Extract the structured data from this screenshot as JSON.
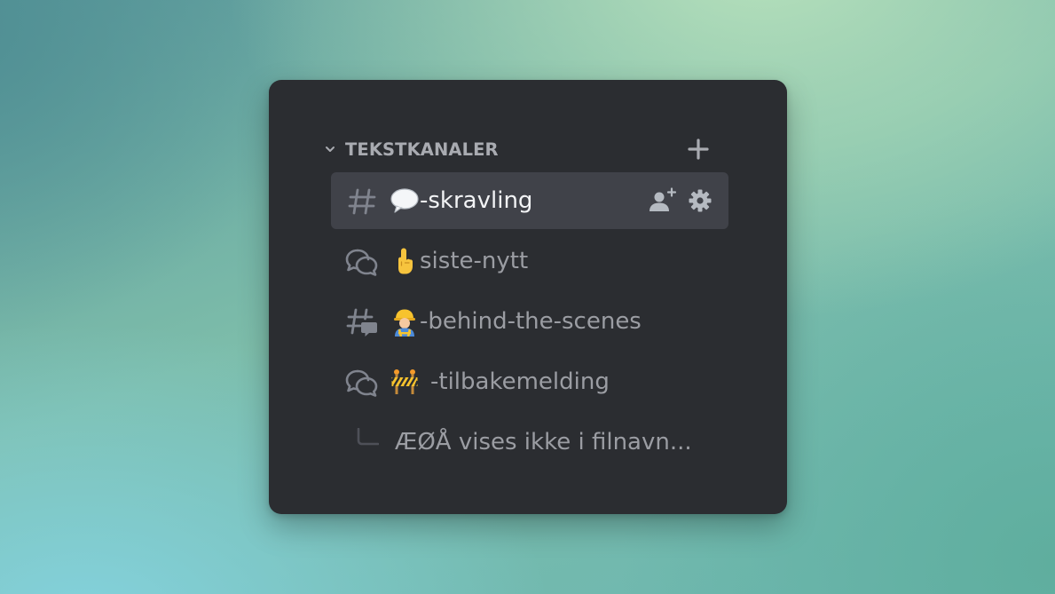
{
  "sidebar": {
    "category": {
      "label": "TEKSTKANALER",
      "collapse_icon": "chevron-down-icon",
      "add_icon": "plus-icon"
    },
    "channels": [
      {
        "type": "text",
        "icon": "hash-icon",
        "emoji": "speech-bubble",
        "name": "-skravling",
        "active": true,
        "actions": [
          "invite-user-icon",
          "gear-icon"
        ]
      },
      {
        "type": "forum",
        "icon": "forum-icon",
        "emoji": "pointing-up",
        "name": "siste-nytt",
        "active": false
      },
      {
        "type": "text-with-threads",
        "icon": "hash-thread-icon",
        "emoji": "construction-worker",
        "name": "-behind-the-scenes",
        "active": false
      },
      {
        "type": "forum",
        "icon": "forum-icon",
        "emoji": "construction-barrier",
        "name": "-tilbakemelding",
        "active": false
      }
    ],
    "thread": {
      "icon": "thread-spine-icon",
      "name": "ÆØÅ vises ikke i filnavn..."
    }
  },
  "colors": {
    "panel_bg": "#2b2d31",
    "active_row_bg": "#404249",
    "text_muted": "#9b9da3",
    "text_active": "#f2f3f5",
    "icon": "#80848e"
  }
}
